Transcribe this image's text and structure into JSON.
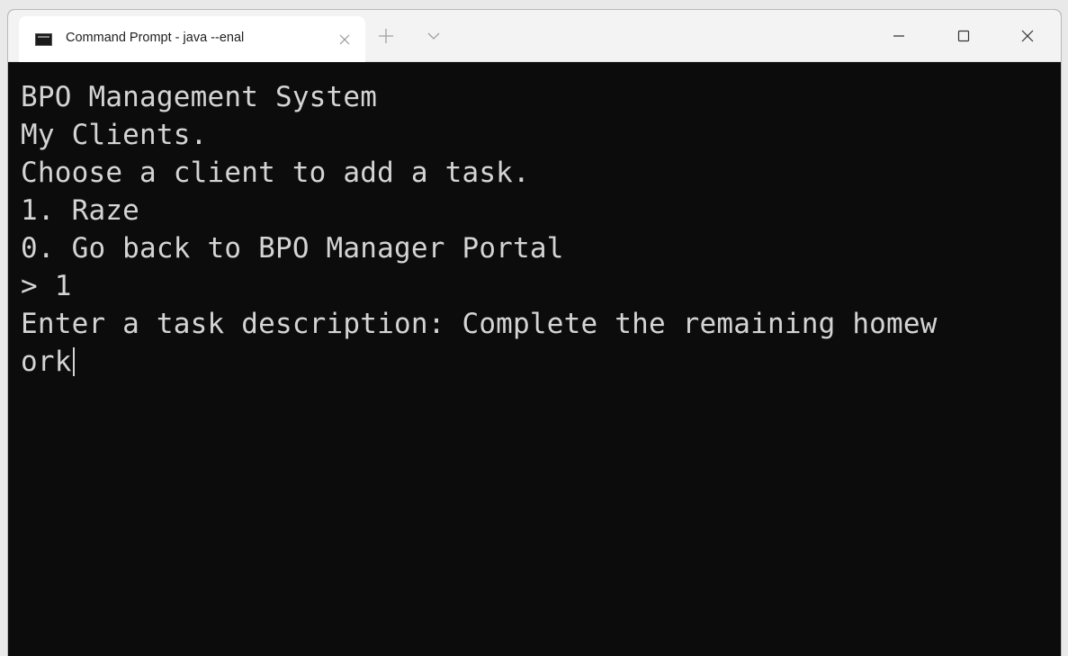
{
  "window": {
    "tab_title": "Command Prompt - java  --enal",
    "icons": {
      "tab_icon": "command-prompt-icon",
      "tab_close": "close-icon",
      "new_tab": "plus-icon",
      "dropdown": "chevron-down-icon",
      "minimize": "minimize-icon",
      "maximize": "maximize-icon",
      "close": "close-icon"
    }
  },
  "terminal": {
    "lines": [
      "BPO Management System",
      "My Clients.",
      "Choose a client to add a task.",
      "1. Raze",
      "0. Go back to BPO Manager Portal",
      "> 1",
      "Enter a task description: Complete the remaining homew",
      "ork"
    ],
    "colors": {
      "background": "#0c0c0c",
      "foreground": "#d4d4d4"
    }
  }
}
